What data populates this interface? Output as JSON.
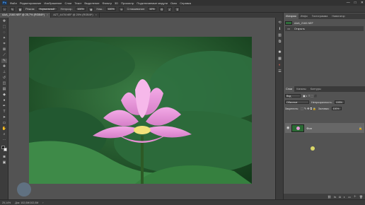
{
  "menubar": {
    "logo": "Ps",
    "items": [
      "Файл",
      "Редактирование",
      "Изображение",
      "Слои",
      "Текст",
      "Выделение",
      "Фильтр",
      "3D",
      "Просмотр",
      "Подключаемые модули",
      "Окно",
      "Справка"
    ],
    "window_controls": [
      "—",
      "□",
      "✕"
    ]
  },
  "options": {
    "mode_label": "Режим:",
    "mode_value": "Нормальный",
    "opacity_label": "Непрозр.:",
    "opacity_value": "100%",
    "flow_label": "Наж.:",
    "flow_value": "100%",
    "smoothing_label": "Сглаживание:",
    "smoothing_value": "10%"
  },
  "tabs": [
    {
      "label": "ААА_2160.NEF @ 25,7% (RGB/8*)",
      "close": "×"
    },
    {
      "label": "AZT_4478.NEF @ 25% (RGB/8*)",
      "close": "×"
    }
  ],
  "toolbar": {
    "tools": [
      "move-icon",
      "marquee-icon",
      "lasso-icon",
      "magic-wand-icon",
      "crop-icon",
      "frame-icon",
      "eyedropper-icon",
      "healing-icon",
      "brush-icon",
      "stamp-icon",
      "history-brush-icon",
      "eraser-icon",
      "gradient-icon",
      "blur-icon",
      "dodge-icon",
      "pen-icon",
      "type-icon",
      "path-select-icon",
      "shape-icon",
      "hand-icon",
      "zoom-icon",
      "more-icon"
    ]
  },
  "history_panel": {
    "tabs": [
      "История",
      "Инфо",
      "Гистограмма",
      "Навигатор"
    ],
    "snapshot_label": "ААА_2160.NEF",
    "step_label": "Открыть"
  },
  "layers_panel": {
    "tabs": [
      "Слои",
      "Каналы",
      "Контуры"
    ],
    "filter_label": "Вид",
    "blend_mode": "Обычные",
    "opacity_label": "Непрозрачность:",
    "opacity_value": "100%",
    "lock_label": "Закрепить:",
    "fill_label": "Заливка:",
    "fill_value": "100%",
    "layer_name": "Фон",
    "lock_icon": "lock-icon"
  },
  "statusbar": {
    "zoom": "25,14%",
    "doc_info": "Док: 102,0M/102,0M",
    "arrow": "›"
  },
  "colors": {
    "accent": "#31a8ff",
    "ui_dark": "#3c3c3c",
    "ui_mid": "#535353"
  }
}
